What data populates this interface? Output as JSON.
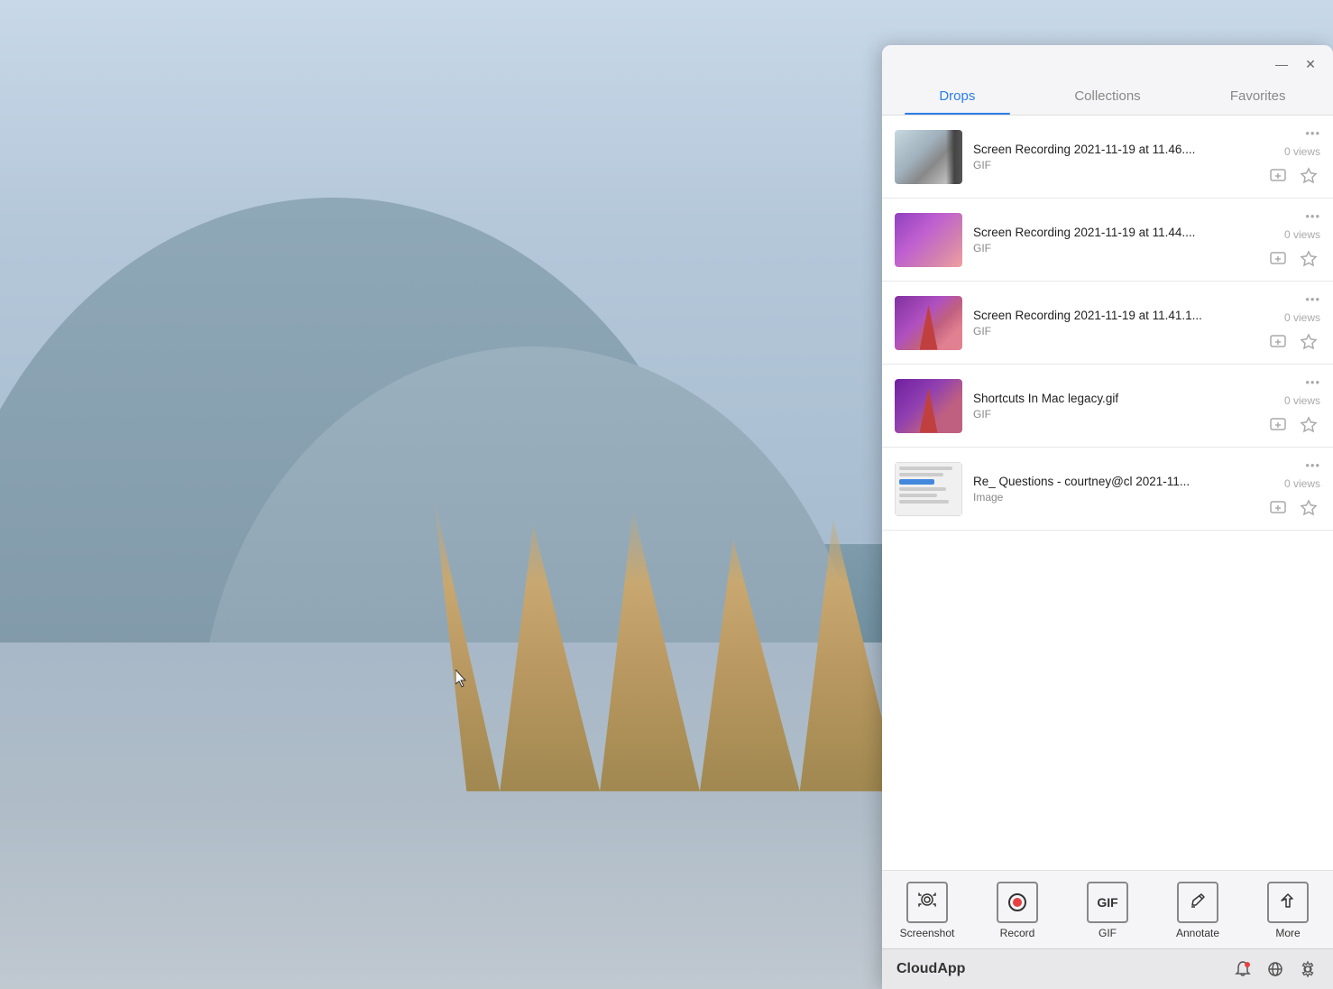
{
  "desktop": {
    "bg_description": "Windows 11 landscape wallpaper with lake and reeds"
  },
  "panel": {
    "tabs": [
      {
        "id": "drops",
        "label": "Drops",
        "active": true
      },
      {
        "id": "collections",
        "label": "Collections",
        "active": false
      },
      {
        "id": "favorites",
        "label": "Favorites",
        "active": false
      }
    ],
    "drops": [
      {
        "id": 1,
        "title": "Screen Recording 2021-11-19 at 11.46....",
        "type": "GIF",
        "views": "0 views",
        "thumb_type": "gif1"
      },
      {
        "id": 2,
        "title": "Screen Recording 2021-11-19 at 11.44....",
        "type": "GIF",
        "views": "0 views",
        "thumb_type": "gif2"
      },
      {
        "id": 3,
        "title": "Screen Recording 2021-11-19 at 11.41.1...",
        "type": "GIF",
        "views": "0 views",
        "thumb_type": "gif3"
      },
      {
        "id": 4,
        "title": "Shortcuts In Mac legacy.gif",
        "type": "GIF",
        "views": "0 views",
        "thumb_type": "gif4"
      },
      {
        "id": 5,
        "title": "Re_ Questions - courtney@cl 2021-11...",
        "type": "Image",
        "views": "0 views",
        "thumb_type": "img"
      }
    ],
    "toolbar": {
      "items": [
        {
          "id": "screenshot",
          "label": "Screenshot",
          "icon": "screenshot"
        },
        {
          "id": "record",
          "label": "Record",
          "icon": "record"
        },
        {
          "id": "gif",
          "label": "GIF",
          "icon": "gif"
        },
        {
          "id": "annotate",
          "label": "Annotate",
          "icon": "annotate"
        },
        {
          "id": "more",
          "label": "More",
          "icon": "more"
        }
      ]
    },
    "bottom": {
      "app_name": "CloudApp",
      "icons": [
        "bell",
        "globe",
        "gear"
      ]
    },
    "title_btns": {
      "minimize": "—",
      "close": "✕"
    }
  }
}
